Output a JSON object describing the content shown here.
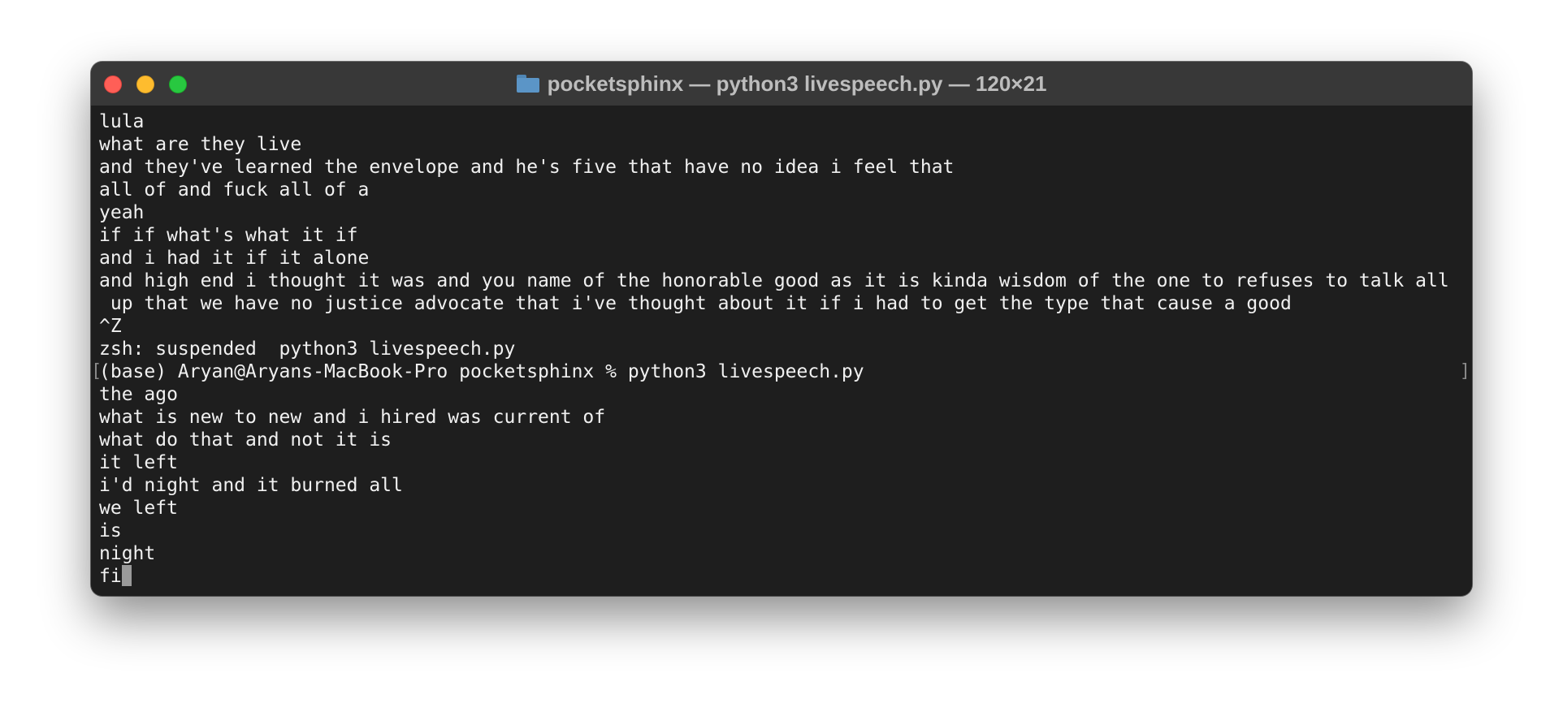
{
  "window": {
    "title": "pocketsphinx — python3 livespeech.py — 120×21",
    "title_icon": "folder-icon"
  },
  "terminal": {
    "lines": [
      "lula",
      "what are they live",
      "and they've learned the envelope and he's five that have no idea i feel that",
      "all of and fuck all of a",
      "yeah",
      "if if what's what it if",
      "and i had it if it alone",
      "and high end i thought it was and you name of the honorable good as it is kinda wisdom of the one to refuses to talk all",
      " up that we have no justice advocate that i've thought about it if i had to get the type that cause a good",
      "^Z",
      "zsh: suspended  python3 livespeech.py",
      "(base) Aryan@Aryans-MacBook-Pro pocketsphinx % python3 livespeech.py",
      "the ago",
      "what is new to new and i hired was current of",
      "what do that and not it is",
      "it left",
      "i'd night and it burned all",
      "we left",
      "is",
      "night",
      "fi"
    ],
    "prompt_marker_left": "[",
    "prompt_marker_right": "]"
  },
  "colors": {
    "background": "#1e1e1e",
    "titlebar": "#383838",
    "text": "#f0f0f0",
    "close": "#ff5f57",
    "minimize": "#febc2e",
    "zoom": "#28c840",
    "folder": "#5b95c7"
  }
}
